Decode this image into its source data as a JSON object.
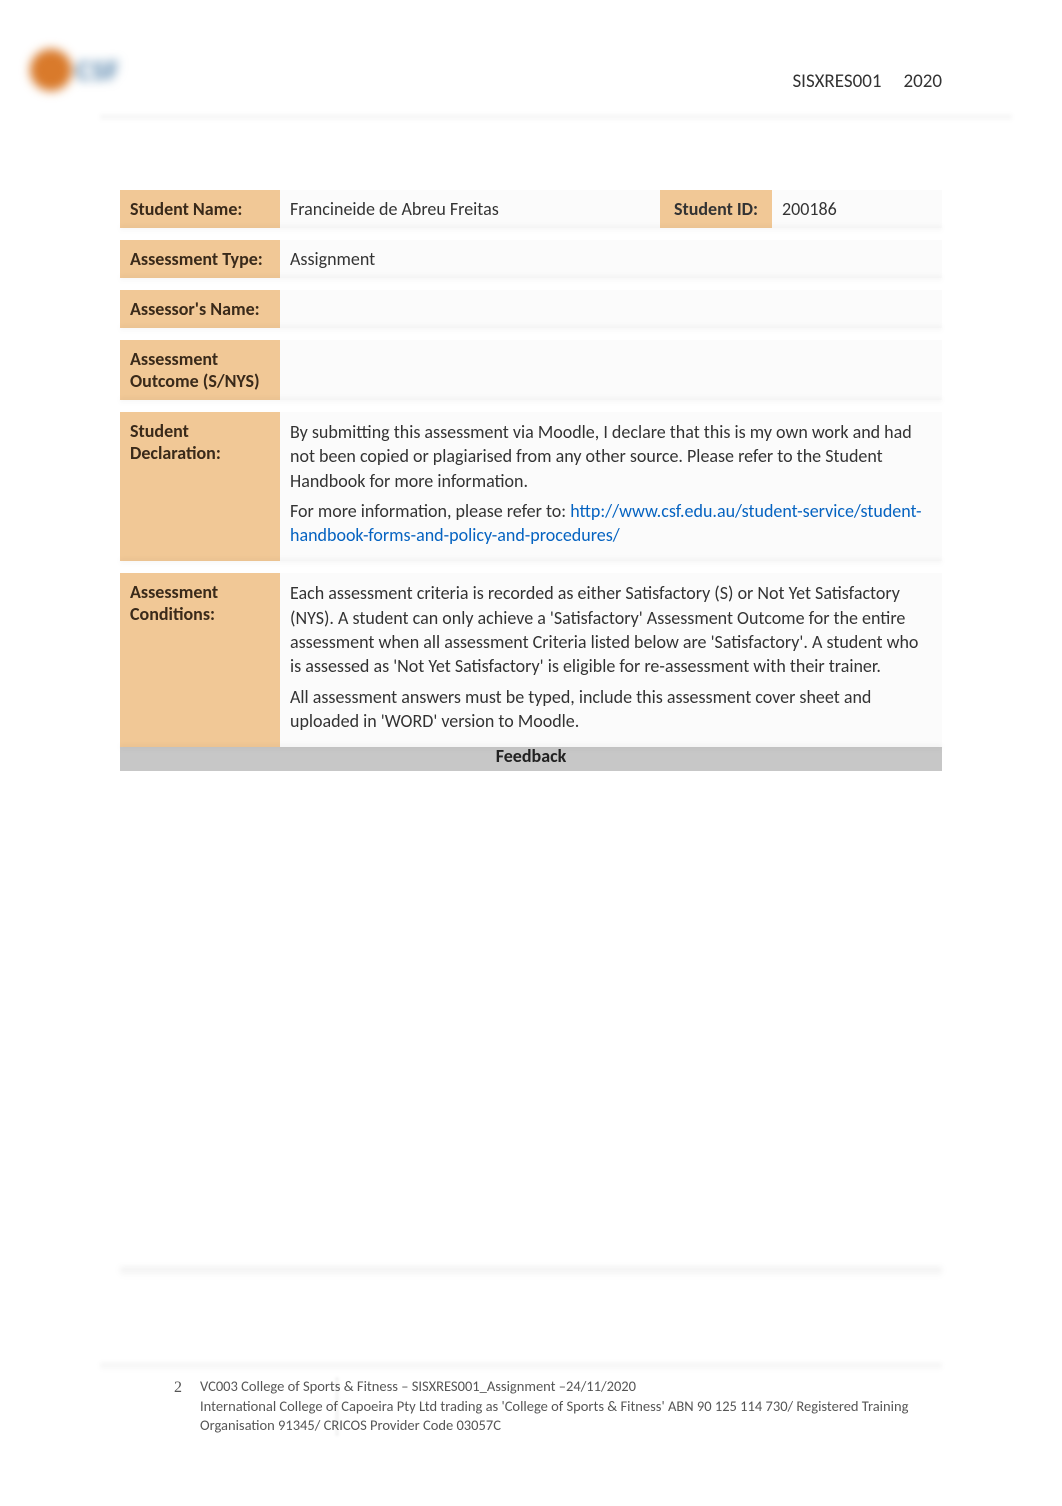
{
  "header": {
    "code": "SISXRES001",
    "year": "2020",
    "logo_text": "CSF"
  },
  "rows": {
    "student_name": {
      "label": "Student Name:",
      "value": "Francineide de Abreu Freitas"
    },
    "student_id": {
      "label": "Student ID:",
      "value": "200186"
    },
    "assessment_type": {
      "label": "Assessment Type:",
      "value": "Assignment"
    },
    "assessor_name": {
      "label": "Assessor's Name:",
      "value": ""
    },
    "assessment_outcome": {
      "label": "Assessment Outcome (S/NYS)",
      "value": ""
    },
    "student_declaration": {
      "label": "Student Declaration:",
      "text1": "By submitting this assessment via Moodle, I declare that this is my own work and had not been copied or plagiarised from any other source. Please refer to the Student Handbook for more information.",
      "text2": "For more information, please refer to: ",
      "link": "http://www.csf.edu.au/student-service/student-handbook-forms-and-policy-and-procedures/"
    },
    "assessment_conditions": {
      "label": "Assessment Conditions:",
      "text1": "Each assessment criteria is recorded as either Satisfactory (S) or Not Yet Satisfactory (NYS). A student can only achieve a 'Satisfactory' Assessment Outcome for the entire assessment when all assessment Criteria listed below are 'Satisfactory'. A student who is assessed as 'Not Yet Satisfactory' is eligible for re-assessment with their trainer.",
      "text2": "All assessment answers must be typed, include this assessment cover sheet and uploaded in 'WORD' version to Moodle."
    }
  },
  "feedback_header": "Feedback",
  "footer": {
    "page": "2",
    "line1": "VC003 College of Sports & Fitness – SISXRES001_Assignment –24/11/2020",
    "line2": "International College of Capoeira Pty Ltd trading as 'College of Sports & Fitness' ABN 90 125 114 730/ Registered Training Organisation 91345/ CRICOS Provider Code 03057C"
  }
}
